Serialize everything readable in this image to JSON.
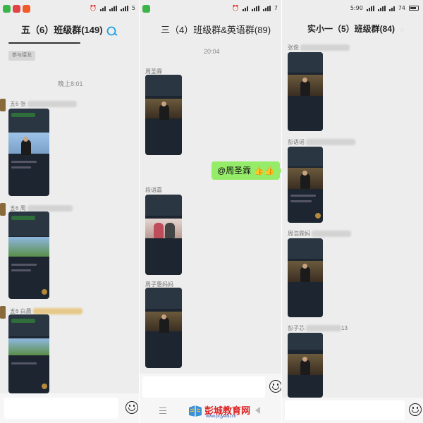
{
  "colors": {
    "background": "#ededed",
    "bubble": "#95ec69",
    "watermark_red": "#dd2222"
  },
  "panel1": {
    "status": {
      "time": "",
      "right_text": "5"
    },
    "title": "五（6）班级群(149)",
    "tag_label": "参与接龙",
    "timestamp": "晚上8:01",
    "messages": [
      {
        "sender": "五6 张"
      },
      {
        "sender": "五6 周"
      },
      {
        "sender": "五6 白晨"
      }
    ],
    "icons": [
      "group-avatar-icon",
      "emoji-icon"
    ]
  },
  "panel2": {
    "status": {
      "right_text": "7"
    },
    "title": "三（4）班级群&英语群(89)",
    "timestamp": "20:04",
    "messages": [
      {
        "sender": "周圣霖"
      },
      {
        "sender": "段语嘉"
      },
      {
        "sender": "周子惠妈妈"
      }
    ],
    "bubble_text": "@周圣霖 👍👍",
    "icons": [
      "emoji-icon",
      "menu-icon",
      "back-icon"
    ]
  },
  "panel3": {
    "status": {
      "time": "5:90",
      "battery": "74"
    },
    "title": "实小一（5）班级群(84)",
    "messages": [
      {
        "sender": "张俊"
      },
      {
        "sender": "彭语诺"
      },
      {
        "sender": "周浩霖妈"
      },
      {
        "sender": "彭子芯",
        "suffix": "13"
      }
    ],
    "icons": [
      "mute-icon",
      "emoji-icon"
    ]
  },
  "watermark": {
    "title": "彭城教育网",
    "url": "www.pcjyedu.cn"
  }
}
